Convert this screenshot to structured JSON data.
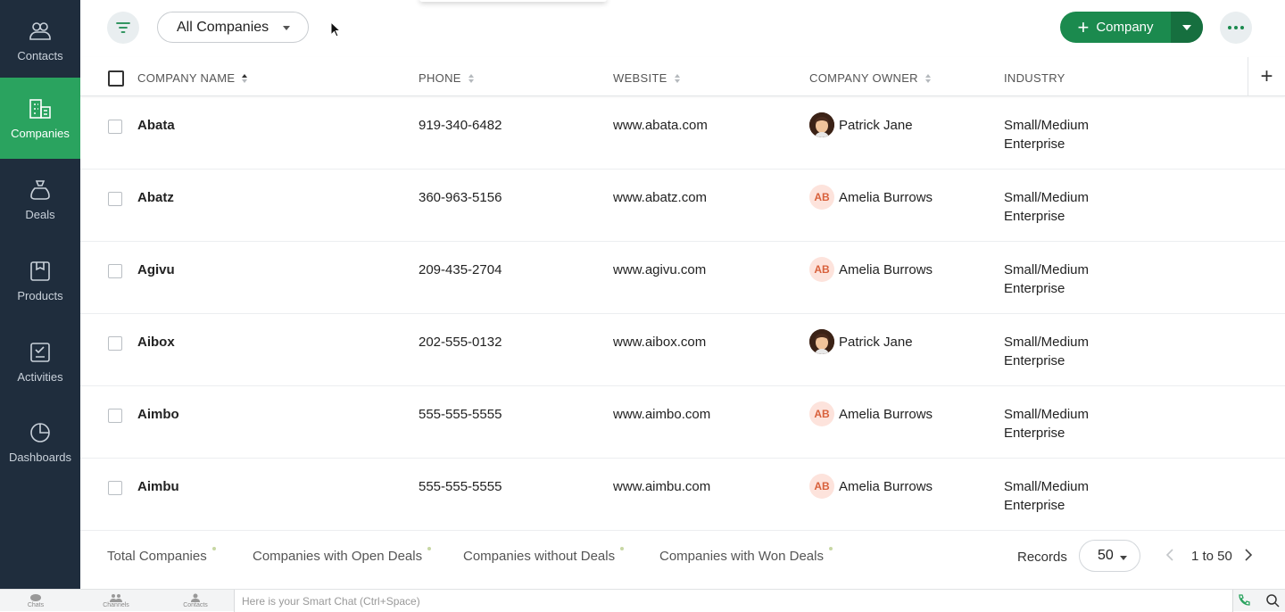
{
  "sidebar": {
    "items": [
      {
        "label": "Contacts",
        "icon": "contacts-icon",
        "active": false
      },
      {
        "label": "Companies",
        "icon": "companies-icon",
        "active": true
      },
      {
        "label": "Deals",
        "icon": "deals-icon",
        "active": false
      },
      {
        "label": "Products",
        "icon": "products-icon",
        "active": false
      },
      {
        "label": "Activities",
        "icon": "activities-icon",
        "active": false
      },
      {
        "label": "Dashboards",
        "icon": "dashboards-icon",
        "active": false
      }
    ]
  },
  "toolbar": {
    "view_label": "All Companies",
    "add_label": "Company"
  },
  "table": {
    "columns": [
      "COMPANY NAME",
      "PHONE",
      "WEBSITE",
      "COMPANY OWNER",
      "INDUSTRY"
    ],
    "rows": [
      {
        "name": "Abata",
        "phone": "919-340-6482",
        "website": "www.abata.com",
        "owner": "Patrick Jane",
        "owner_avatar": "photo",
        "industry": "Small/Medium Enterprise"
      },
      {
        "name": "Abatz",
        "phone": "360-963-5156",
        "website": "www.abatz.com",
        "owner": "Amelia Burrows",
        "owner_avatar": "AB",
        "industry": "Small/Medium Enterprise"
      },
      {
        "name": "Agivu",
        "phone": "209-435-2704",
        "website": "www.agivu.com",
        "owner": "Amelia Burrows",
        "owner_avatar": "AB",
        "industry": "Small/Medium Enterprise"
      },
      {
        "name": "Aibox",
        "phone": "202-555-0132",
        "website": "www.aibox.com",
        "owner": "Patrick Jane",
        "owner_avatar": "photo",
        "industry": "Small/Medium Enterprise"
      },
      {
        "name": "Aimbo",
        "phone": "555-555-5555",
        "website": "www.aimbo.com",
        "owner": "Amelia Burrows",
        "owner_avatar": "AB",
        "industry": "Small/Medium Enterprise"
      },
      {
        "name": "Aimbu",
        "phone": "555-555-5555",
        "website": "www.aimbu.com",
        "owner": "Amelia Burrows",
        "owner_avatar": "AB",
        "industry": "Small/Medium Enterprise"
      }
    ]
  },
  "footer": {
    "stats": [
      "Total Companies",
      "Companies with Open Deals",
      "Companies without Deals",
      "Companies with Won Deals"
    ],
    "records_label": "Records",
    "records_value": "50",
    "pager_text": "1 to 50"
  },
  "bottombar": {
    "items": [
      "Chats",
      "Channels",
      "Contacts"
    ],
    "smartchat_placeholder": "Here is your Smart Chat (Ctrl+Space)"
  },
  "colors": {
    "sidebar_bg": "#1f2d3d",
    "accent": "#2aa35f",
    "button_green": "#1b8a4e",
    "avatar_ab_bg": "#fde3dc",
    "avatar_ab_text": "#d8613c"
  }
}
